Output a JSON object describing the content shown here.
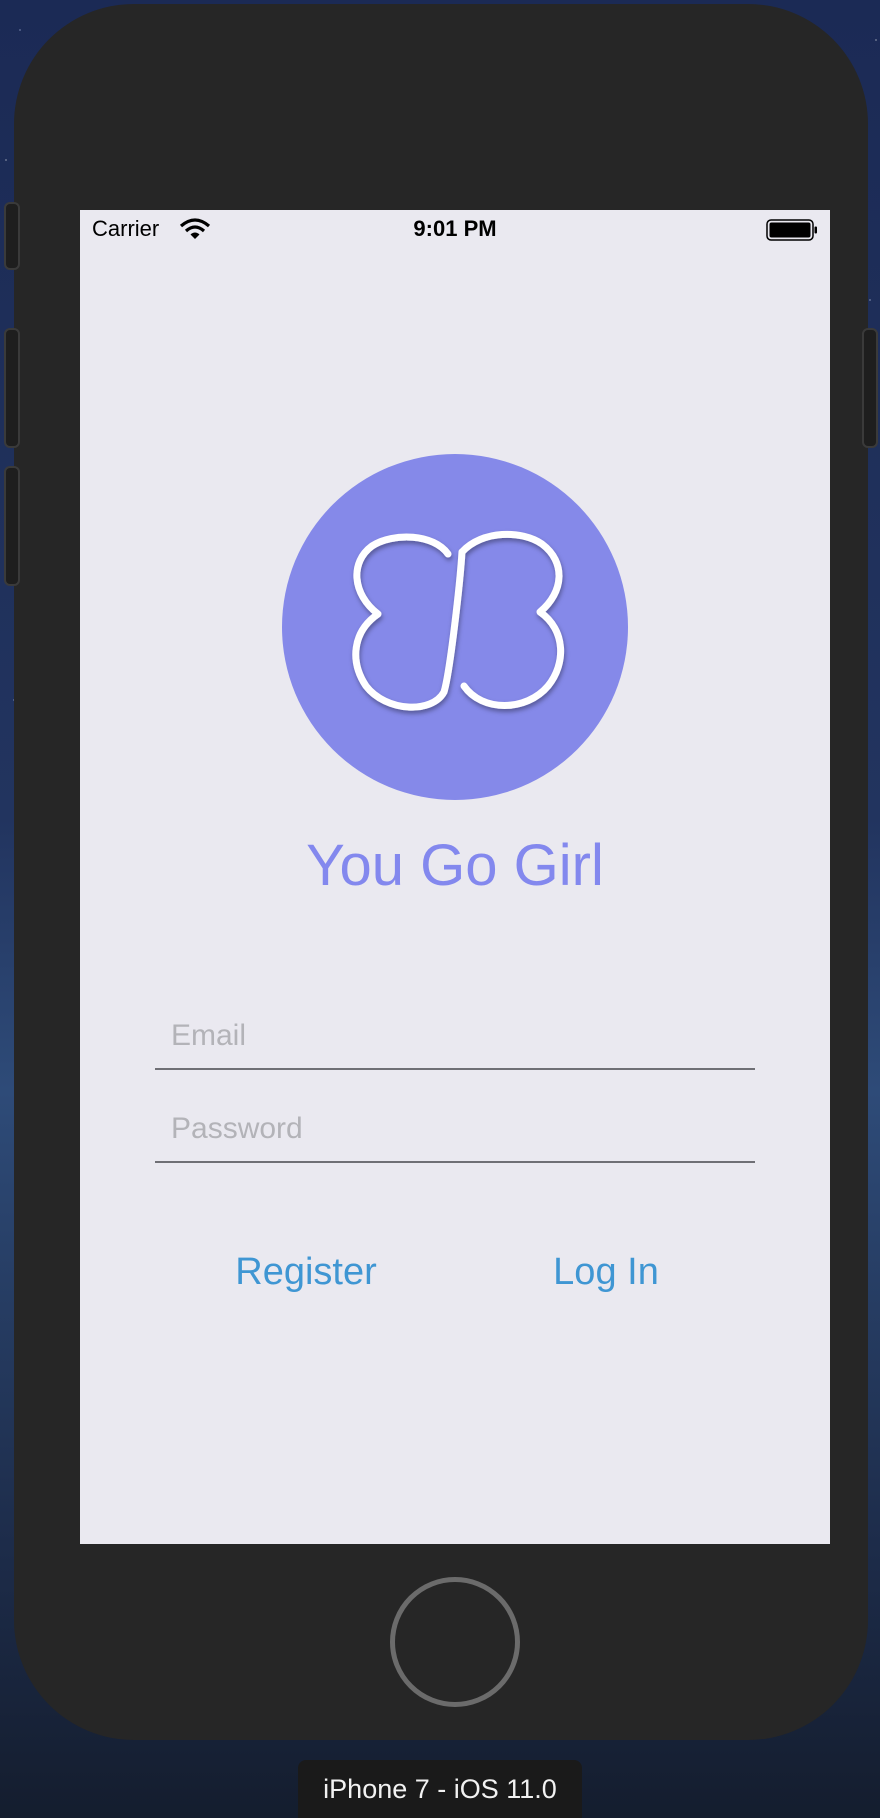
{
  "status_bar": {
    "carrier": "Carrier",
    "time": "9:01 PM",
    "wifi_icon": "wifi-icon",
    "battery_icon": "battery-full-icon"
  },
  "app": {
    "logo_icon": "butterfly-logo-icon",
    "title": "You Go Girl",
    "accent_color": "#8589e9",
    "title_color": "#8388ee"
  },
  "form": {
    "email": {
      "value": "",
      "placeholder": "Email"
    },
    "password": {
      "value": "",
      "placeholder": "Password"
    }
  },
  "actions": {
    "register_label": "Register",
    "login_label": "Log In",
    "link_color": "#3f96d3"
  },
  "simulator": {
    "device_label": "iPhone 7 - iOS 11.0"
  }
}
